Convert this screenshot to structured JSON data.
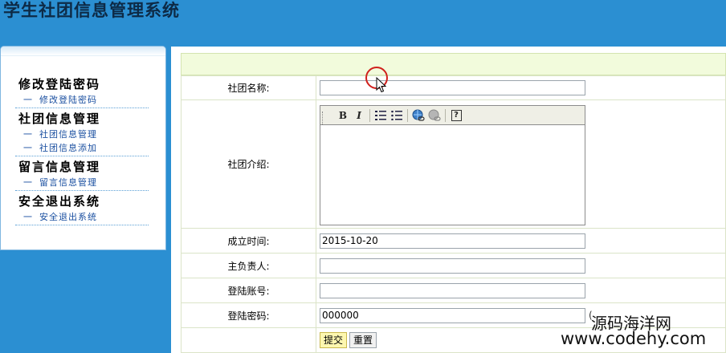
{
  "app": {
    "title": "学生社团信息管理系统"
  },
  "sidebar": {
    "groups": [
      {
        "heading": "修改登陆密码",
        "items": [
          {
            "prefix": "一",
            "label": "修改登陆密码"
          }
        ]
      },
      {
        "heading": "社团信息管理",
        "items": [
          {
            "prefix": "一",
            "label": "社团信息管理"
          },
          {
            "prefix": "一",
            "label": "社团信息添加"
          }
        ]
      },
      {
        "heading": "留言信息管理",
        "items": [
          {
            "prefix": "一",
            "label": "留言信息管理"
          }
        ]
      },
      {
        "heading": "安全退出系统",
        "items": [
          {
            "prefix": "一",
            "label": "安全退出系统"
          }
        ]
      }
    ]
  },
  "form": {
    "name_label": "社团名称:",
    "name_value": "",
    "intro_label": "社团介绍:",
    "date_label": "成立时间:",
    "date_value": "2015-10-20",
    "owner_label": "主负责人:",
    "owner_value": "",
    "account_label": "登陆账号:",
    "account_value": "",
    "password_label": "登陆密码:",
    "password_value": "000000",
    "password_hint": "(",
    "submit_label": "提交",
    "reset_label": "重置"
  },
  "editor": {
    "toolbar": {
      "bold": "B",
      "italic": "I",
      "help": "?"
    }
  },
  "watermark": {
    "line1": "源码海洋网",
    "line2": "www.codehy.com"
  },
  "colors": {
    "background": "#2b8fd2",
    "header_bar": "#f2fbdc",
    "link": "#1a4fa0"
  }
}
